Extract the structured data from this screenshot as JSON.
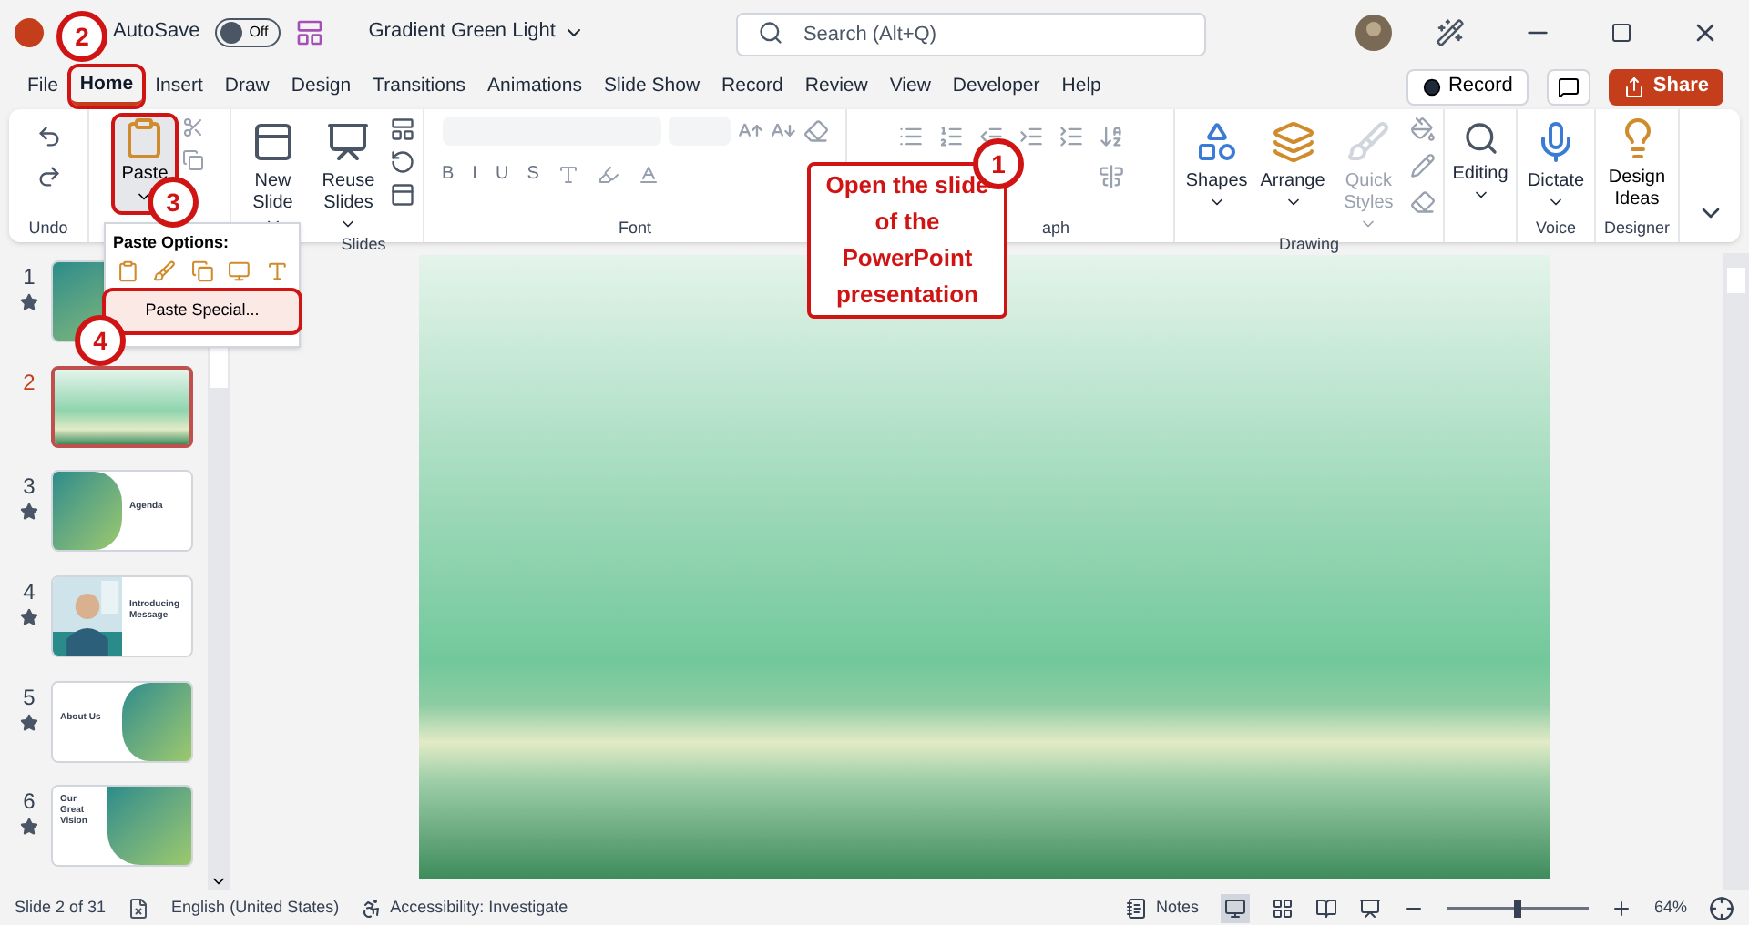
{
  "titlebar": {
    "autosave_label": "AutoSave",
    "autosave_on": false,
    "autosave_state": "Off",
    "file_name": "Gradient Green Light",
    "search_placeholder": "Search (Alt+Q)"
  },
  "tabs": [
    {
      "label": "File",
      "selected": false
    },
    {
      "label": "Home",
      "selected": true
    },
    {
      "label": "Insert",
      "selected": false
    },
    {
      "label": "Draw",
      "selected": false
    },
    {
      "label": "Design",
      "selected": false
    },
    {
      "label": "Transitions",
      "selected": false
    },
    {
      "label": "Animations",
      "selected": false
    },
    {
      "label": "Slide Show",
      "selected": false
    },
    {
      "label": "Record",
      "selected": false
    },
    {
      "label": "Review",
      "selected": false
    },
    {
      "label": "View",
      "selected": false
    },
    {
      "label": "Developer",
      "selected": false
    },
    {
      "label": "Help",
      "selected": false
    }
  ],
  "header_buttons": {
    "record": "Record",
    "share": "Share"
  },
  "ribbon": {
    "undo_group": "Undo",
    "paste": "Paste",
    "new_slide": "New Slide",
    "reuse_slides": "Reuse Slides",
    "slides_group": "Slides",
    "format_letters": [
      "B",
      "I",
      "U",
      "S"
    ],
    "font_group": "Font",
    "paragraph_group": "aph",
    "shapes": "Shapes",
    "arrange": "Arrange",
    "quick_styles": {
      "label": "Quick Styles",
      "disabled": true
    },
    "drawing_group": "Drawing",
    "editing": "Editing",
    "dictate": "Dictate",
    "voice_group": "Voice",
    "design_ideas": "Design Ideas",
    "designer_group": "Designer"
  },
  "paste_menu": {
    "title": "Paste Options:",
    "item": "Paste Special..."
  },
  "frames": {
    "selected_tab": true,
    "paste_button": true,
    "paste_special": true
  },
  "slides": [
    {
      "number": "1",
      "starred": true,
      "selected": false,
      "kind": "cover"
    },
    {
      "number": "2",
      "starred": false,
      "selected": true,
      "kind": "blank"
    },
    {
      "number": "3",
      "starred": true,
      "selected": false,
      "kind": "agenda",
      "title": "Agenda"
    },
    {
      "number": "4",
      "starred": true,
      "selected": false,
      "kind": "intro",
      "title": "Introducing Message"
    },
    {
      "number": "5",
      "starred": true,
      "selected": false,
      "kind": "about",
      "title": "About Us"
    },
    {
      "number": "6",
      "starred": true,
      "selected": false,
      "kind": "vision",
      "title": "Our Great Vision"
    }
  ],
  "annotations": [
    {
      "number": "1"
    },
    {
      "number": "2"
    },
    {
      "number": "3"
    },
    {
      "number": "4"
    }
  ],
  "callout": "Open the slide of the PowerPoint presentation",
  "status_bar": {
    "slide_info": "Slide 2 of 31",
    "language": "English (United States)",
    "accessibility": "Accessibility: Investigate",
    "notes": "Notes",
    "zoom": "64%",
    "zoom_slider": {
      "level": 0.5
    }
  }
}
